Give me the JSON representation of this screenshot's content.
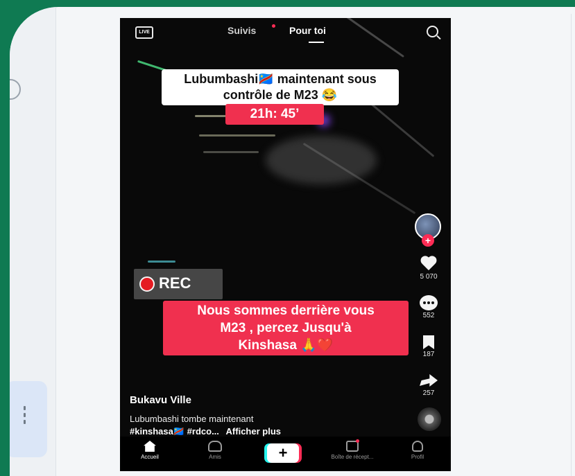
{
  "feed": {
    "tabs": {
      "live": "LIVE",
      "following": "Suivis",
      "for_you": "Pour toi"
    }
  },
  "video": {
    "caption_top": "Lubumbashi🇨🇩 maintenant sous contrôle de M23 😂",
    "caption_time": "21h: 45’",
    "rec_label": "REC",
    "caption_red_l1": "Nous sommes derrière vous",
    "caption_red_l2": "M23 , percez Jusqu'à",
    "caption_red_l3": "Kinshasa 🙏❤️",
    "author": "Bukavu Ville",
    "description": "Lubumbashi tombe maintenant",
    "hashtags": "#kinshasa🇨🇩 #rdco...",
    "more_label": "Afficher plus"
  },
  "actions": {
    "follow": "+",
    "likes": "5 070",
    "comments": "552",
    "saves": "187",
    "shares": "257"
  },
  "navbar": {
    "home": "Accueil",
    "friends": "Amis",
    "create": "+",
    "inbox": "Boîte de récept...",
    "profile": "Profil"
  },
  "colors": {
    "background": "#0f7a52",
    "accent_red": "#f0304f",
    "tiktok_cyan": "#25f4ee",
    "tiktok_pink": "#fe2c55"
  }
}
